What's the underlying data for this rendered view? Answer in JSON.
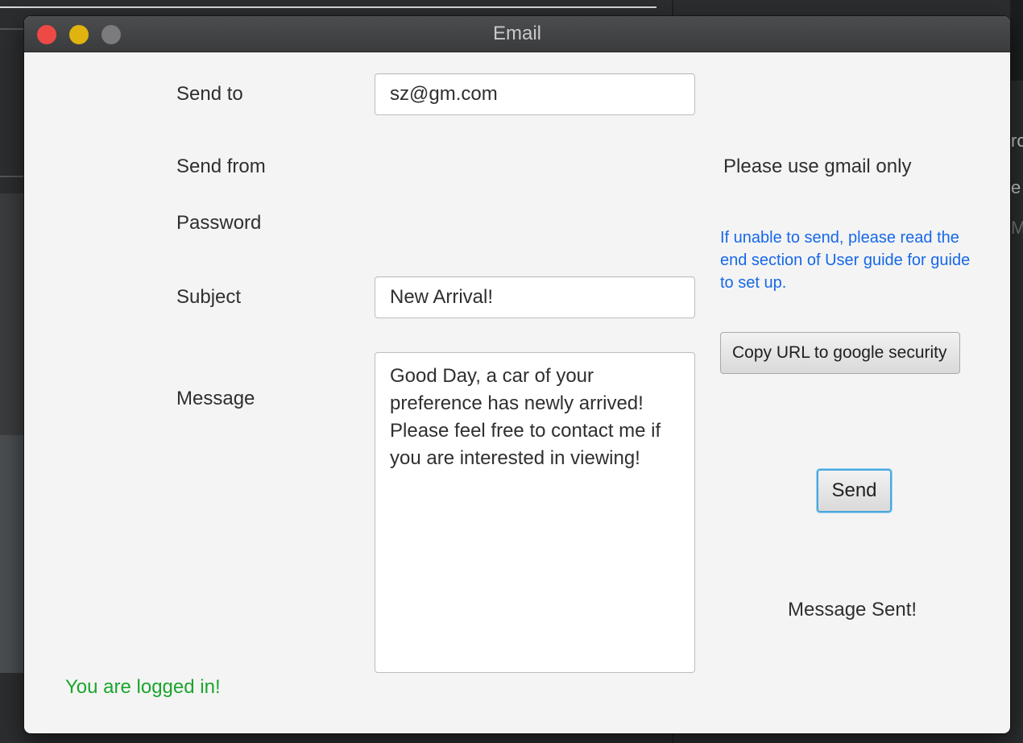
{
  "window": {
    "title": "Email"
  },
  "form": {
    "send_to_label": "Send to",
    "send_to_value": "sz@gm.com",
    "send_from_label": "Send from",
    "password_label": "Password",
    "subject_label": "Subject",
    "subject_value": "New Arrival!",
    "message_label": "Message",
    "message_value": "Good Day, a car of your preference has newly arrived! Please feel free to contact me if you are interested in viewing!"
  },
  "side": {
    "gmail_note": "Please use gmail only",
    "help_text": "If unable to send, please read the end section of User guide for guide to set up.",
    "copy_url_button": "Copy URL to google security",
    "send_button": "Send",
    "send_status": "Message Sent!"
  },
  "status": {
    "login_status": "You are logged in!"
  },
  "background": {
    "partial_texts": [
      "ro",
      "e",
      "M"
    ]
  },
  "colors": {
    "help_text": "#1668e8",
    "login_status": "#1aa52c",
    "default_button_border": "#47a9df",
    "close_button": "#ee4a45",
    "minimize_button": "#e0b30f",
    "zoom_button": "#7b7b7d"
  }
}
